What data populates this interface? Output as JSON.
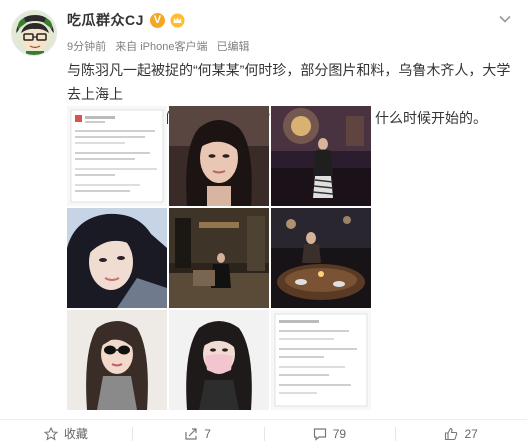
{
  "post": {
    "nickname": "吃瓜群众CJ",
    "verified_badge": "V",
    "time": "9分钟前",
    "source": "来自 iPhone客户端",
    "edited": "已编辑",
    "content_line1": "与陈羽凡一起被捉的“何某某”何时珍，部分图片和料，乌鲁木齐人，大学去上海上",
    "content_line2": "的。问题是，他们真在一起了吗？真在一起的话，什么时候开始的。",
    "images": [
      {
        "kind": "chat-screenshot"
      },
      {
        "kind": "selfie-portrait"
      },
      {
        "kind": "restaurant-photo"
      },
      {
        "kind": "selfie-closeup"
      },
      {
        "kind": "hotel-lobby"
      },
      {
        "kind": "dinner-table"
      },
      {
        "kind": "sunglasses-selfie"
      },
      {
        "kind": "mask-selfie"
      },
      {
        "kind": "chat-screenshot"
      }
    ]
  },
  "toolbar": {
    "favorite_label": "收藏",
    "repost_count": "7",
    "comment_count": "79",
    "like_count": "27"
  },
  "icons": {
    "favorite": "star-icon",
    "repost": "repost-icon",
    "comment": "comment-icon",
    "like": "thumbs-up-icon",
    "menu": "chevron-down-icon"
  },
  "colors": {
    "text": "#333333",
    "meta": "#808080",
    "badge": "#f5a623",
    "divider": "#eeeeee"
  }
}
